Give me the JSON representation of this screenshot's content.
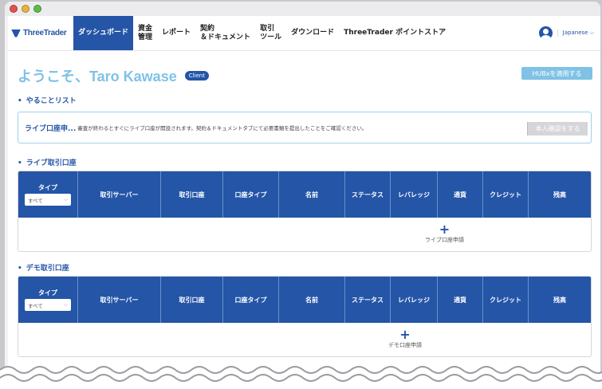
{
  "window": {
    "dots": [
      "#e2524a",
      "#e6b33a",
      "#5dbb4a"
    ]
  },
  "nav": {
    "logo": "ThreeTrader",
    "items": [
      {
        "label": "ダッシュボード",
        "active": true
      },
      {
        "label": "資金\n管理"
      },
      {
        "label": "レポート"
      },
      {
        "label": "契約\n＆ドキュメント"
      },
      {
        "label": "取引\nツール"
      },
      {
        "label": "ダウンロード"
      },
      {
        "label": "ThreeTrader ポイントストア"
      }
    ],
    "language": "Japanese ⌵"
  },
  "welcome": {
    "greeting": "ようこそ、Taro Kawase",
    "badge": "Client",
    "hubx_button": "HUBxを適用する"
  },
  "todo": {
    "section_title": "やることリスト",
    "item_title": "ライブ口座申...",
    "item_desc": "審査が終わるとすぐにライブ口座が開設されます。契約＆ドキュメントタブにて必要書類を提出したことをご確認ください。",
    "button": "本人確認をする"
  },
  "live_accounts": {
    "section_title": "ライブ取引口座",
    "type_label": "タイプ",
    "type_value": "すべて",
    "columns": [
      "取引サーバー",
      "取引口座",
      "口座タイプ",
      "名前",
      "ステータス",
      "レバレッジ",
      "通貨",
      "クレジット",
      "残高"
    ],
    "add_label": "ライブ口座申請"
  },
  "demo_accounts": {
    "section_title": "デモ取引口座",
    "type_label": "タイプ",
    "type_value": "すべて",
    "columns": [
      "取引サーバー",
      "取引口座",
      "口座タイプ",
      "名前",
      "ステータス",
      "レバレッジ",
      "通貨",
      "クレジット",
      "残高"
    ],
    "add_label": "デモ口座申請"
  },
  "colors": {
    "primary": "#2455a7",
    "accent": "#7fc2e6"
  }
}
